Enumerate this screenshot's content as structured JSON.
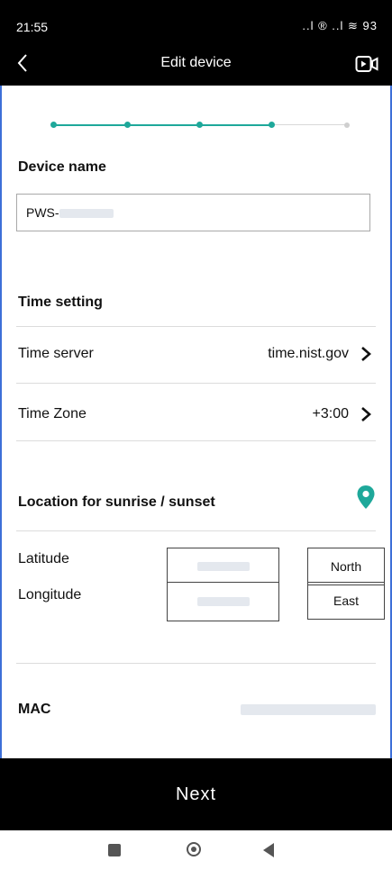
{
  "status": {
    "time": "21:55",
    "icons_text": "..l ® ..l ≋ 93"
  },
  "header": {
    "title": "Edit device",
    "back_icon": "chevron-left-icon",
    "video_icon": "video-icon"
  },
  "stepper": {
    "total_steps": 5,
    "current_step": 4,
    "active_color": "#1ea89a"
  },
  "device": {
    "name_label": "Device name",
    "name_value": "PWS-"
  },
  "time_setting": {
    "heading": "Time setting",
    "rows": [
      {
        "label": "Time server",
        "value": "time.nist.gov"
      },
      {
        "label": "Time Zone",
        "value": "+3:00"
      }
    ]
  },
  "location": {
    "heading": "Location for sunrise / sunset",
    "pin_icon": "location-pin-icon",
    "pin_color": "#1ea89a",
    "latitude": {
      "label": "Latitude",
      "direction": "North"
    },
    "longitude": {
      "label": "Longitude",
      "direction": "East"
    }
  },
  "mac": {
    "label": "MAC"
  },
  "footer": {
    "next_label": "Next"
  }
}
